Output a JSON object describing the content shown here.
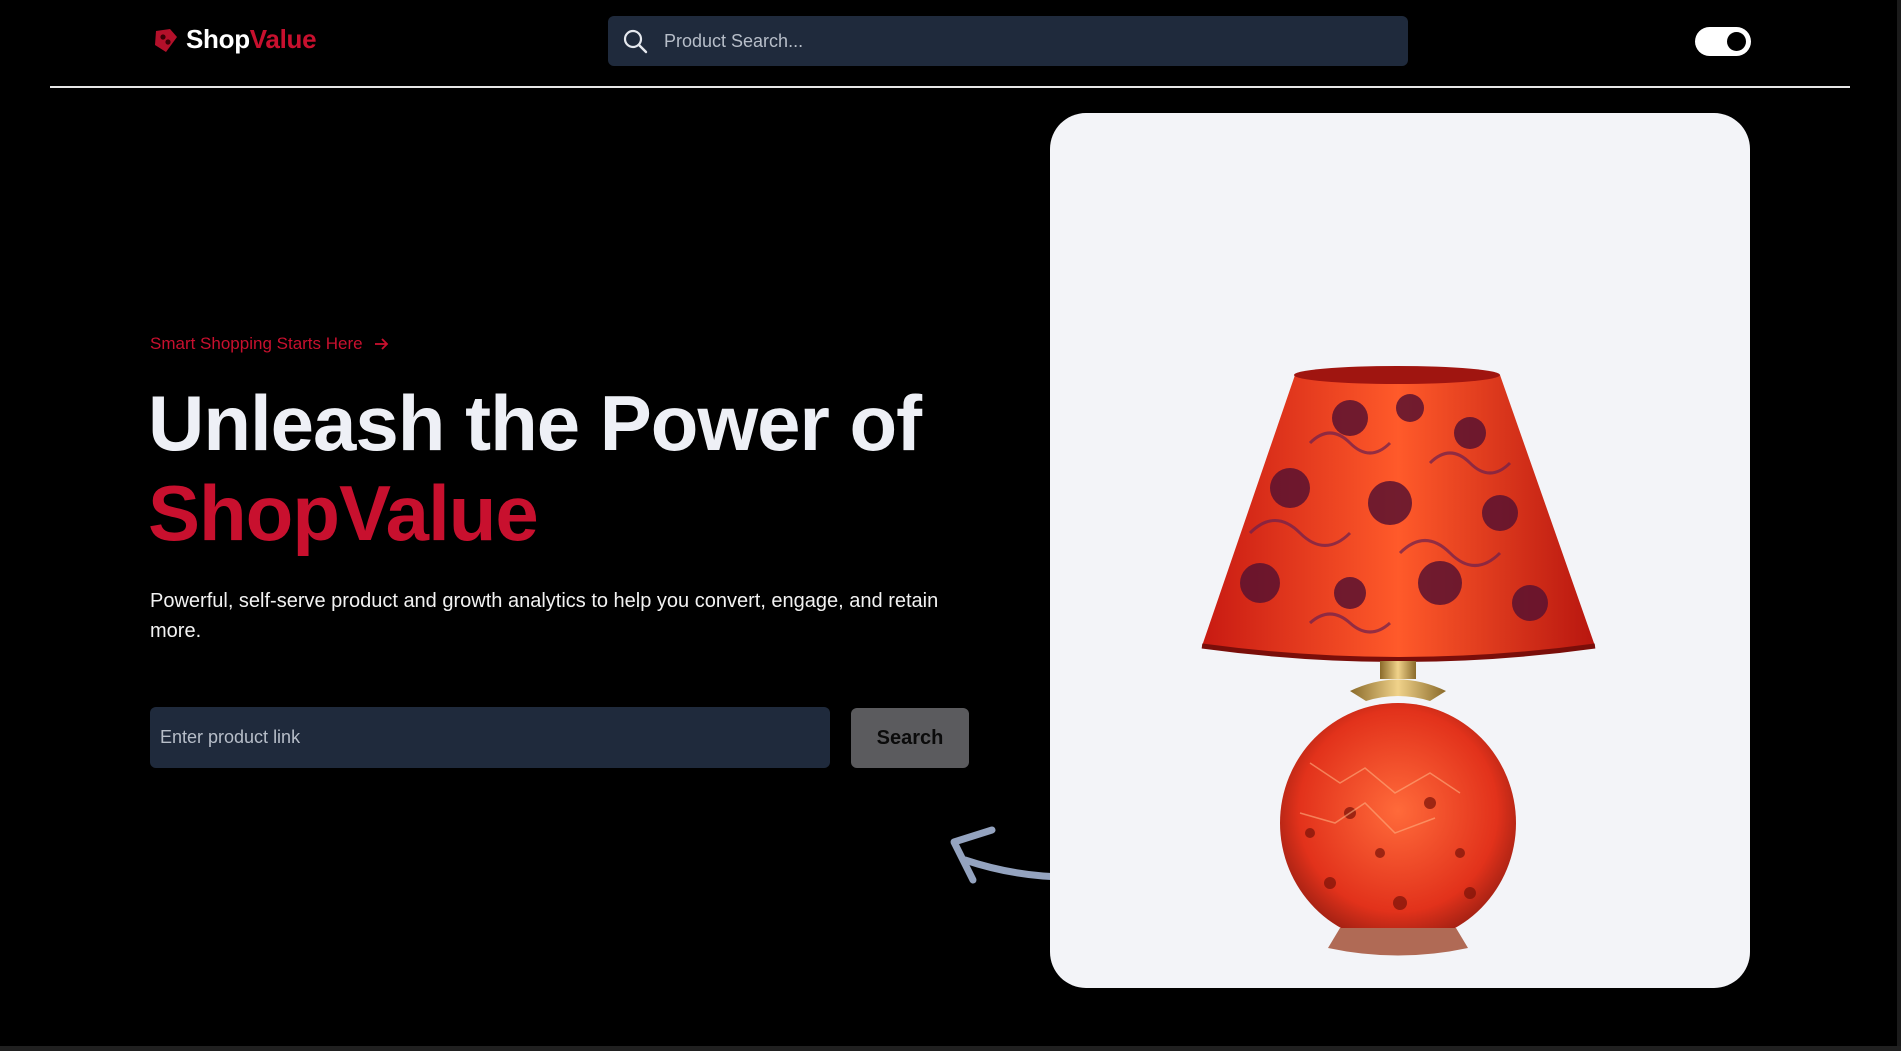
{
  "brand": {
    "part1": "Shop",
    "part2": "Value"
  },
  "header": {
    "search": {
      "placeholder": "Product Search..."
    },
    "theme_toggle": {
      "state": "on"
    }
  },
  "hero": {
    "tagline": "Smart Shopping Starts Here",
    "headline_line1": "Unleash the Power of",
    "headline_line2": "ShopValue",
    "subtext": "Powerful, self-serve product and growth analytics to help you convert, engage, and retain more.",
    "link_input": {
      "placeholder": "Enter product link"
    },
    "search_button": "Search"
  },
  "product_image": {
    "icon": "table-lamp-illustration"
  },
  "colors": {
    "background": "#000000",
    "accent": "#c8102e",
    "input_bg": "#1f2a3c",
    "button_bg": "#5b5b5e",
    "card_bg": "#f3f4f8",
    "arrow": "#94a3bf"
  }
}
